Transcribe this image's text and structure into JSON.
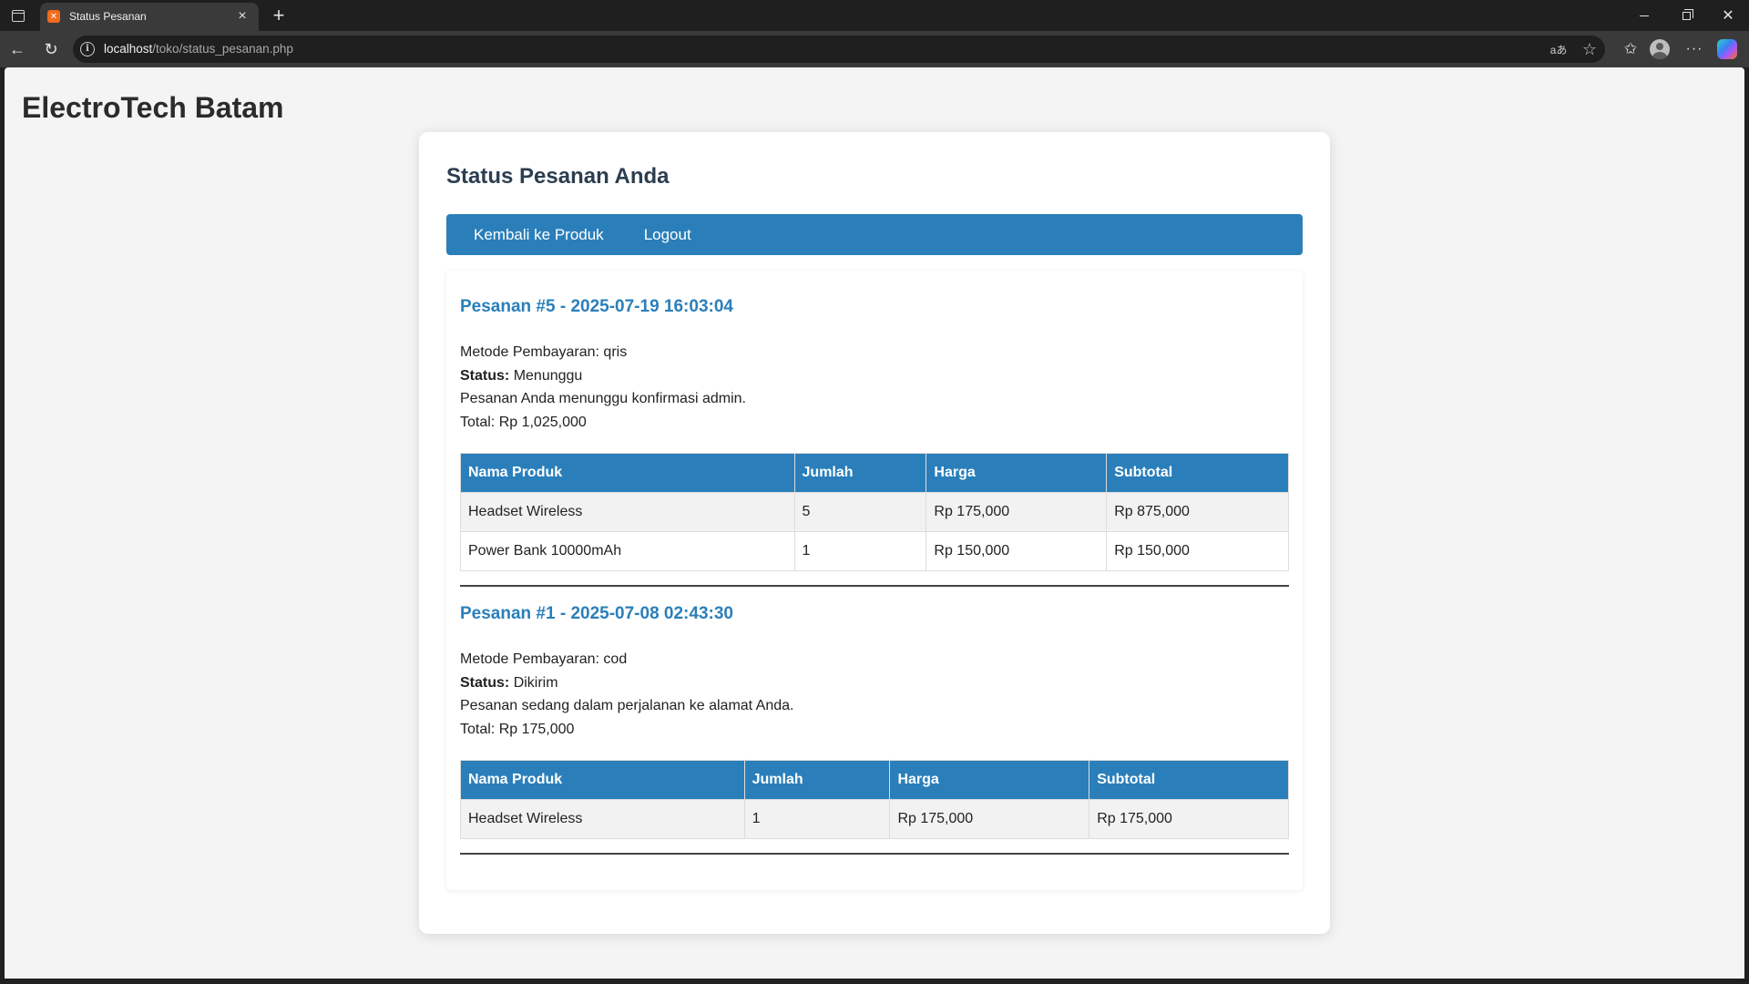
{
  "browser": {
    "tab_title": "Status Pesanan",
    "url_host": "localhost",
    "url_path": "/toko/status_pesanan.php"
  },
  "page": {
    "brand": "ElectroTech Batam",
    "title": "Status Pesanan Anda",
    "menu": {
      "back_label": "Kembali ke Produk",
      "logout_label": "Logout"
    },
    "table_headers": [
      "Nama Produk",
      "Jumlah",
      "Harga",
      "Subtotal"
    ],
    "labels": {
      "method_prefix": "Metode Pembayaran: ",
      "status_label": "Status:",
      "total_prefix": "Total: "
    },
    "orders": [
      {
        "heading": "Pesanan #5 - 2025-07-19 16:03:04",
        "method": "Metode Pembayaran: qris",
        "status": "Menunggu",
        "message": "Pesanan Anda menunggu konfirmasi admin.",
        "total": "Total: Rp 1,025,000",
        "items": [
          {
            "name": "Headset Wireless",
            "qty": "5",
            "price": "Rp 175,000",
            "subtotal": "Rp 875,000"
          },
          {
            "name": "Power Bank 10000mAh",
            "qty": "1",
            "price": "Rp 150,000",
            "subtotal": "Rp 150,000"
          }
        ]
      },
      {
        "heading": "Pesanan #1 - 2025-07-08 02:43:30",
        "method": "Metode Pembayaran: cod",
        "status": "Dikirim",
        "message": "Pesanan sedang dalam perjalanan ke alamat Anda.",
        "total": "Total: Rp 175,000",
        "items": [
          {
            "name": "Headset Wireless",
            "qty": "1",
            "price": "Rp 175,000",
            "subtotal": "Rp 175,000"
          }
        ]
      }
    ]
  },
  "colors": {
    "accent": "#2a7fba",
    "title": "#2c3e50",
    "page_bg": "#f4f4f4"
  }
}
